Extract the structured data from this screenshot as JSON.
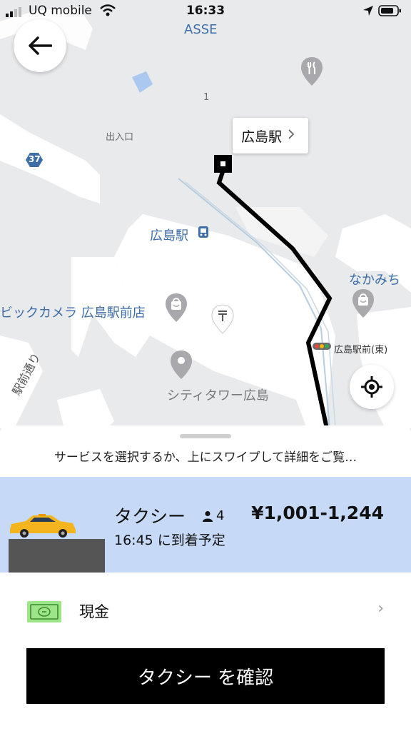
{
  "status_bar": {
    "carrier": "UQ mobile",
    "time": "16:33"
  },
  "map": {
    "labels": {
      "asse": "ASSE",
      "number_one": "1",
      "entrance": "出入口",
      "route_37": "37",
      "hiroshima_station": "広島駅",
      "nakamichi": "なかみち",
      "bic_camera": "ビックカメラ 広島駅前店",
      "hiroshima_ekimae_east": "広島駅前(東)",
      "city_tower": "シティタワー広島",
      "ekimae_dori": "駅前通り"
    },
    "callout_label": "広島駅",
    "route_color": "#000000"
  },
  "sheet": {
    "hint": "サービスを選択するか、上にスワイプして詳細をご覧…",
    "taxi": {
      "name": "タクシー",
      "seats": "4",
      "eta": "16:45 に到着予定",
      "price": "¥1,001-1,244",
      "highlight_color": "#c6d9f6"
    },
    "payment": {
      "label": "現金",
      "chevron": "›"
    },
    "confirm_label": "タクシー を確認"
  }
}
